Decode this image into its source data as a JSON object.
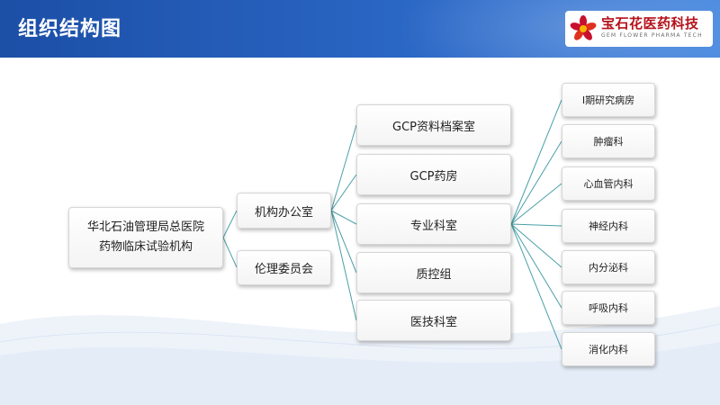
{
  "header": {
    "title": "组织结构图",
    "logo_name": "宝石花医药科技",
    "logo_sub": "GEM FLOWER PHARMA TECH",
    "logo_icon": "flower-logo-icon"
  },
  "colors": {
    "header_start": "#1c4fa6",
    "header_end": "#4b8ae0",
    "connector": "#4aa0a8",
    "brand_red": "#b5121b"
  },
  "org": {
    "root": {
      "line1": "华北石油管理局总医院",
      "line2": "药物临床试验机构"
    },
    "level1": [
      {
        "label": "机构办公室"
      },
      {
        "label": "伦理委员会"
      }
    ],
    "level2": [
      {
        "label": "GCP资料档案室"
      },
      {
        "label": "GCP药房"
      },
      {
        "label": "专业科室"
      },
      {
        "label": "质控组"
      },
      {
        "label": "医技科室"
      }
    ],
    "level3": [
      {
        "label": "I期研究病房"
      },
      {
        "label": "肿瘤科"
      },
      {
        "label": "心血管内科"
      },
      {
        "label": "神经内科"
      },
      {
        "label": "内分泌科"
      },
      {
        "label": "呼吸内科"
      },
      {
        "label": "消化内科"
      }
    ]
  }
}
